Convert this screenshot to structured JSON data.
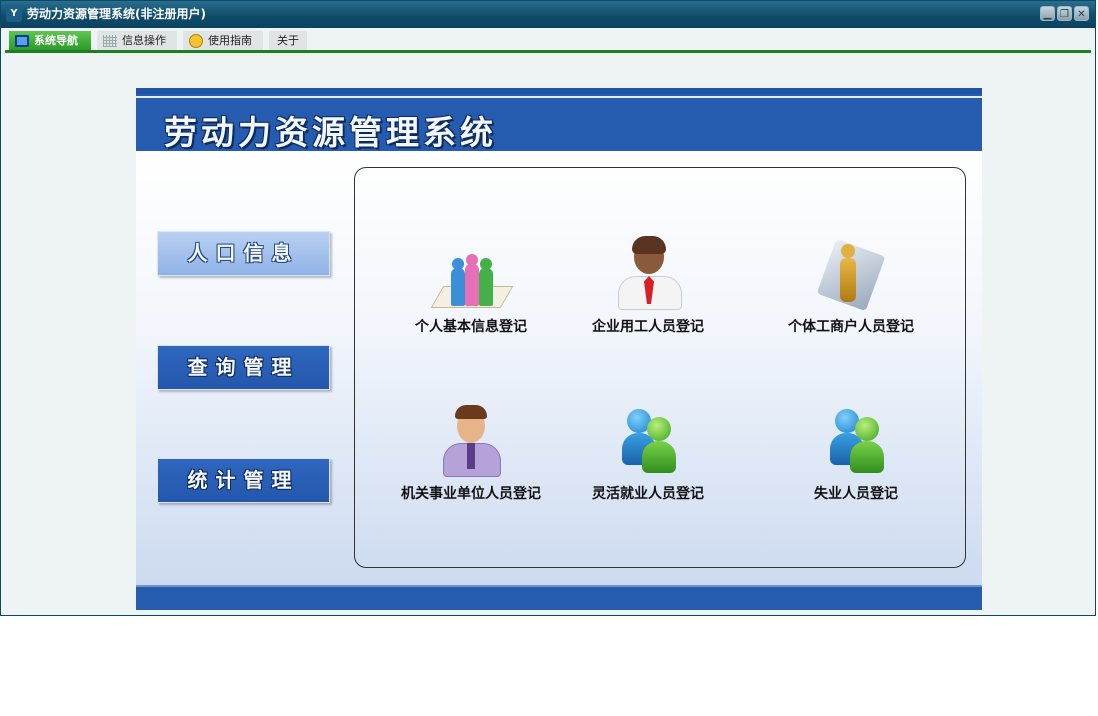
{
  "window": {
    "title": "劳动力资源管理系统(非注册用户)",
    "app_icon": "Y"
  },
  "tabs": [
    {
      "label": "系统导航",
      "icon": "monitor-icon",
      "active": true
    },
    {
      "label": "信息操作",
      "icon": "grid-icon",
      "active": false
    },
    {
      "label": "使用指南",
      "icon": "guide-icon",
      "active": false
    },
    {
      "label": "关于",
      "icon": "",
      "active": false
    }
  ],
  "banner": {
    "title": "劳动力资源管理系统"
  },
  "side_menu": [
    {
      "label": "人口信息"
    },
    {
      "label": "查询管理"
    },
    {
      "label": "统计管理"
    }
  ],
  "cards": [
    {
      "label": "个人基本信息登记",
      "icon": "people-group-icon"
    },
    {
      "label": "企业用工人员登记",
      "icon": "businessman-icon"
    },
    {
      "label": "个体工商户人员登记",
      "icon": "figure-document-icon"
    },
    {
      "label": "机关事业单位人员登记",
      "icon": "official-icon"
    },
    {
      "label": "灵活就业人员登记",
      "icon": "smiling-users-icon"
    },
    {
      "label": "失业人员登记",
      "icon": "users-icon"
    }
  ],
  "colors": {
    "banner": "#255cb0",
    "tab_active": "#3aa832",
    "tab_underline": "#1e7f22",
    "titlebar": "#0f4d6b"
  }
}
